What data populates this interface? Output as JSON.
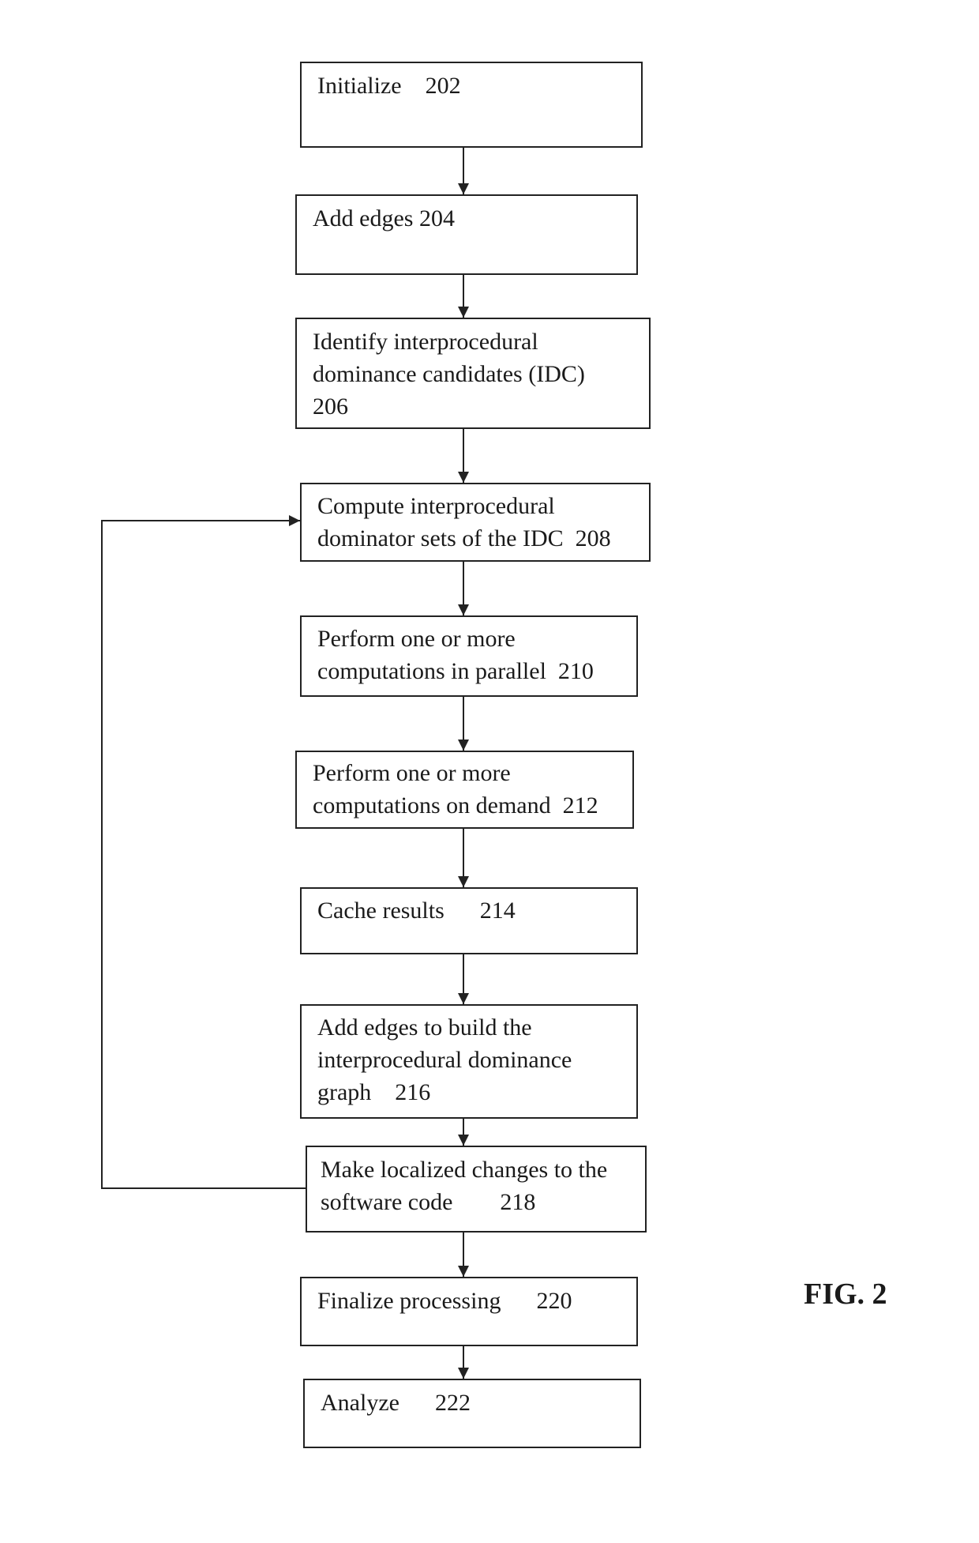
{
  "figure": {
    "label": "FIG. 2",
    "line_color": "#222222",
    "steps": [
      {
        "id": "202",
        "lines": [
          "Initialize    202"
        ]
      },
      {
        "id": "204",
        "lines": [
          "Add edges 204"
        ]
      },
      {
        "id": "206",
        "lines": [
          "Identify interprocedural",
          "dominance candidates (IDC)",
          "206"
        ]
      },
      {
        "id": "208",
        "lines": [
          "Compute interprocedural",
          "dominator sets of the IDC  208"
        ]
      },
      {
        "id": "210",
        "lines": [
          "Perform one or more",
          "computations in parallel  210"
        ]
      },
      {
        "id": "212",
        "lines": [
          "Perform one or more",
          "computations on demand  212"
        ]
      },
      {
        "id": "214",
        "lines": [
          "Cache results      214"
        ]
      },
      {
        "id": "216",
        "lines": [
          "Add edges to build the",
          "interprocedural dominance",
          "graph    216"
        ]
      },
      {
        "id": "218",
        "lines": [
          "Make localized changes to the",
          "software code        218"
        ]
      },
      {
        "id": "220",
        "lines": [
          "Finalize processing      220"
        ]
      },
      {
        "id": "222",
        "lines": [
          "Analyze      222"
        ]
      }
    ],
    "connections": [
      {
        "from": "202",
        "to": "204"
      },
      {
        "from": "204",
        "to": "206"
      },
      {
        "from": "206",
        "to": "208"
      },
      {
        "from": "208",
        "to": "210"
      },
      {
        "from": "210",
        "to": "212"
      },
      {
        "from": "212",
        "to": "214"
      },
      {
        "from": "214",
        "to": "216"
      },
      {
        "from": "216",
        "to": "218"
      },
      {
        "from": "218",
        "to": "220"
      },
      {
        "from": "220",
        "to": "222"
      },
      {
        "from": "218",
        "to": "208",
        "type": "feedback-loop"
      }
    ]
  }
}
